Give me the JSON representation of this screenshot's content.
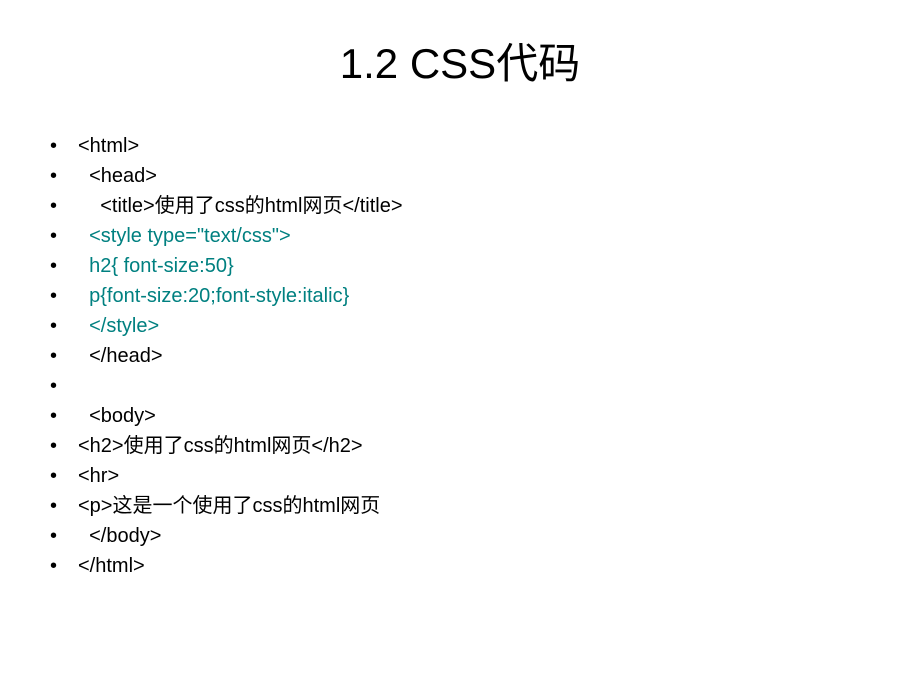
{
  "title": "1.2 CSS代码",
  "watermark": "",
  "lines": [
    {
      "text": "<html>",
      "color": "black",
      "indent": 1
    },
    {
      "text": "<head>",
      "color": "black",
      "indent": 2
    },
    {
      "text": "<title>使用了css的html网页</title>",
      "color": "black",
      "indent": 3
    },
    {
      "text": "<style type=\"text/css\">",
      "color": "teal",
      "indent": 2
    },
    {
      "text": "h2{ font-size:50}",
      "color": "teal",
      "indent": 2
    },
    {
      "text": "p{font-size:20;font-style:italic}",
      "color": "teal",
      "indent": 2
    },
    {
      "text": "</style>",
      "color": "teal",
      "indent": 2
    },
    {
      "text": "</head>",
      "color": "black",
      "indent": 2
    },
    {
      "text": "",
      "color": "black",
      "indent": 2
    },
    {
      "text": "<body>",
      "color": "black",
      "indent": 2
    },
    {
      "text": "<h2>使用了css的html网页</h2>",
      "color": "black",
      "indent": 1
    },
    {
      "text": "<hr>",
      "color": "black",
      "indent": 1
    },
    {
      "text": "<p>这是一个使用了css的html网页",
      "color": "black",
      "indent": 1
    },
    {
      "text": "</body>",
      "color": "black",
      "indent": 2
    },
    {
      "text": "</html>",
      "color": "black",
      "indent": 1
    }
  ]
}
